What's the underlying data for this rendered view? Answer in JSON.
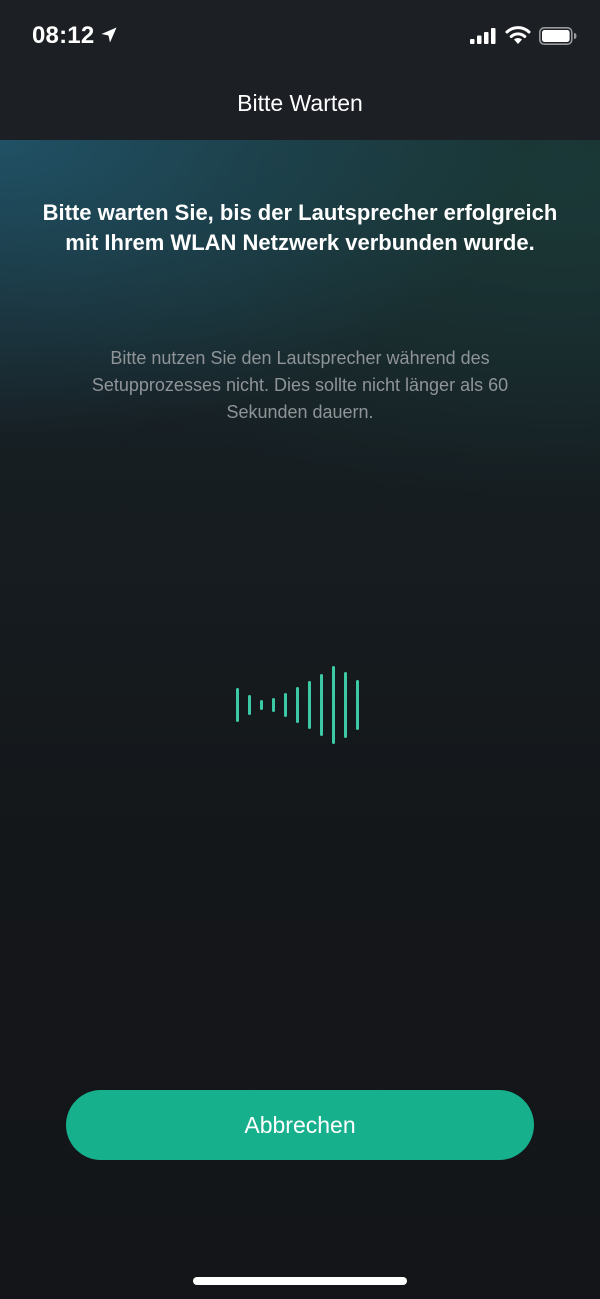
{
  "status_bar": {
    "time": "08:12",
    "icons": [
      "location-arrow-icon",
      "cellular-signal-icon",
      "wifi-icon",
      "battery-icon"
    ]
  },
  "nav": {
    "title": "Bitte Warten"
  },
  "main": {
    "headline": "Bitte warten Sie, bis der Lautsprecher erfolgreich mit Ihrem WLAN Netzwerk verbunden wurde.",
    "description": "Bitte nutzen Sie den Lautsprecher während des Setupprozesses nicht. Dies sollte nicht länger als 60 Sekunden dauern.",
    "animation_icon": "sound-wave-icon"
  },
  "actions": {
    "cancel_label": "Abbrechen"
  },
  "colors": {
    "accent": "#17b08c",
    "wave": "#3cc9a6",
    "background": "#14171a",
    "topbar": "#1c1f23",
    "description_text": "#8f9498"
  }
}
